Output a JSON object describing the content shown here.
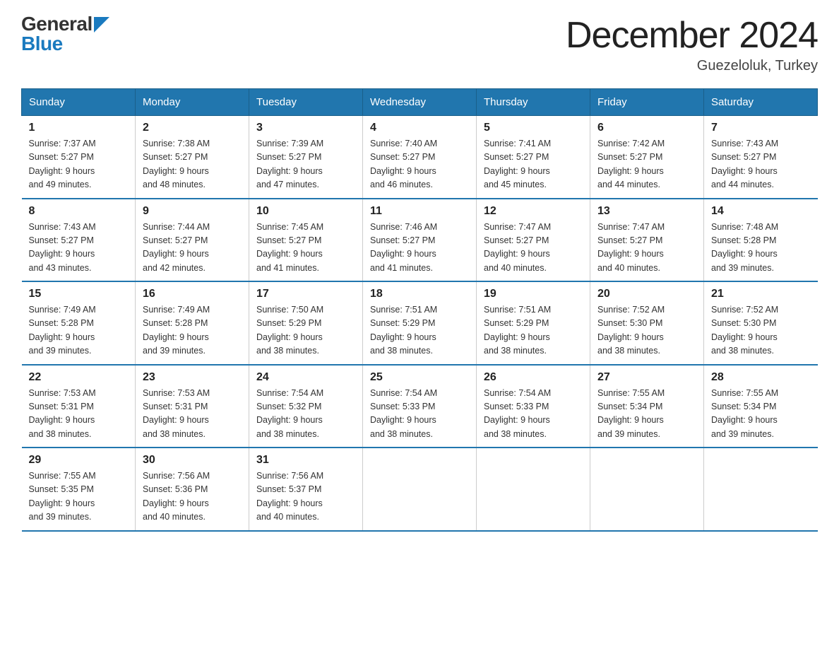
{
  "logo": {
    "general": "General",
    "blue": "Blue"
  },
  "title": "December 2024",
  "location": "Guezeloluk, Turkey",
  "weekdays": [
    "Sunday",
    "Monday",
    "Tuesday",
    "Wednesday",
    "Thursday",
    "Friday",
    "Saturday"
  ],
  "weeks": [
    [
      {
        "day": "1",
        "sunrise": "7:37 AM",
        "sunset": "5:27 PM",
        "daylight": "9 hours and 49 minutes."
      },
      {
        "day": "2",
        "sunrise": "7:38 AM",
        "sunset": "5:27 PM",
        "daylight": "9 hours and 48 minutes."
      },
      {
        "day": "3",
        "sunrise": "7:39 AM",
        "sunset": "5:27 PM",
        "daylight": "9 hours and 47 minutes."
      },
      {
        "day": "4",
        "sunrise": "7:40 AM",
        "sunset": "5:27 PM",
        "daylight": "9 hours and 46 minutes."
      },
      {
        "day": "5",
        "sunrise": "7:41 AM",
        "sunset": "5:27 PM",
        "daylight": "9 hours and 45 minutes."
      },
      {
        "day": "6",
        "sunrise": "7:42 AM",
        "sunset": "5:27 PM",
        "daylight": "9 hours and 44 minutes."
      },
      {
        "day": "7",
        "sunrise": "7:43 AM",
        "sunset": "5:27 PM",
        "daylight": "9 hours and 44 minutes."
      }
    ],
    [
      {
        "day": "8",
        "sunrise": "7:43 AM",
        "sunset": "5:27 PM",
        "daylight": "9 hours and 43 minutes."
      },
      {
        "day": "9",
        "sunrise": "7:44 AM",
        "sunset": "5:27 PM",
        "daylight": "9 hours and 42 minutes."
      },
      {
        "day": "10",
        "sunrise": "7:45 AM",
        "sunset": "5:27 PM",
        "daylight": "9 hours and 41 minutes."
      },
      {
        "day": "11",
        "sunrise": "7:46 AM",
        "sunset": "5:27 PM",
        "daylight": "9 hours and 41 minutes."
      },
      {
        "day": "12",
        "sunrise": "7:47 AM",
        "sunset": "5:27 PM",
        "daylight": "9 hours and 40 minutes."
      },
      {
        "day": "13",
        "sunrise": "7:47 AM",
        "sunset": "5:27 PM",
        "daylight": "9 hours and 40 minutes."
      },
      {
        "day": "14",
        "sunrise": "7:48 AM",
        "sunset": "5:28 PM",
        "daylight": "9 hours and 39 minutes."
      }
    ],
    [
      {
        "day": "15",
        "sunrise": "7:49 AM",
        "sunset": "5:28 PM",
        "daylight": "9 hours and 39 minutes."
      },
      {
        "day": "16",
        "sunrise": "7:49 AM",
        "sunset": "5:28 PM",
        "daylight": "9 hours and 39 minutes."
      },
      {
        "day": "17",
        "sunrise": "7:50 AM",
        "sunset": "5:29 PM",
        "daylight": "9 hours and 38 minutes."
      },
      {
        "day": "18",
        "sunrise": "7:51 AM",
        "sunset": "5:29 PM",
        "daylight": "9 hours and 38 minutes."
      },
      {
        "day": "19",
        "sunrise": "7:51 AM",
        "sunset": "5:29 PM",
        "daylight": "9 hours and 38 minutes."
      },
      {
        "day": "20",
        "sunrise": "7:52 AM",
        "sunset": "5:30 PM",
        "daylight": "9 hours and 38 minutes."
      },
      {
        "day": "21",
        "sunrise": "7:52 AM",
        "sunset": "5:30 PM",
        "daylight": "9 hours and 38 minutes."
      }
    ],
    [
      {
        "day": "22",
        "sunrise": "7:53 AM",
        "sunset": "5:31 PM",
        "daylight": "9 hours and 38 minutes."
      },
      {
        "day": "23",
        "sunrise": "7:53 AM",
        "sunset": "5:31 PM",
        "daylight": "9 hours and 38 minutes."
      },
      {
        "day": "24",
        "sunrise": "7:54 AM",
        "sunset": "5:32 PM",
        "daylight": "9 hours and 38 minutes."
      },
      {
        "day": "25",
        "sunrise": "7:54 AM",
        "sunset": "5:33 PM",
        "daylight": "9 hours and 38 minutes."
      },
      {
        "day": "26",
        "sunrise": "7:54 AM",
        "sunset": "5:33 PM",
        "daylight": "9 hours and 38 minutes."
      },
      {
        "day": "27",
        "sunrise": "7:55 AM",
        "sunset": "5:34 PM",
        "daylight": "9 hours and 39 minutes."
      },
      {
        "day": "28",
        "sunrise": "7:55 AM",
        "sunset": "5:34 PM",
        "daylight": "9 hours and 39 minutes."
      }
    ],
    [
      {
        "day": "29",
        "sunrise": "7:55 AM",
        "sunset": "5:35 PM",
        "daylight": "9 hours and 39 minutes."
      },
      {
        "day": "30",
        "sunrise": "7:56 AM",
        "sunset": "5:36 PM",
        "daylight": "9 hours and 40 minutes."
      },
      {
        "day": "31",
        "sunrise": "7:56 AM",
        "sunset": "5:37 PM",
        "daylight": "9 hours and 40 minutes."
      },
      null,
      null,
      null,
      null
    ]
  ],
  "labels": {
    "sunrise": "Sunrise:",
    "sunset": "Sunset:",
    "daylight": "Daylight:"
  }
}
